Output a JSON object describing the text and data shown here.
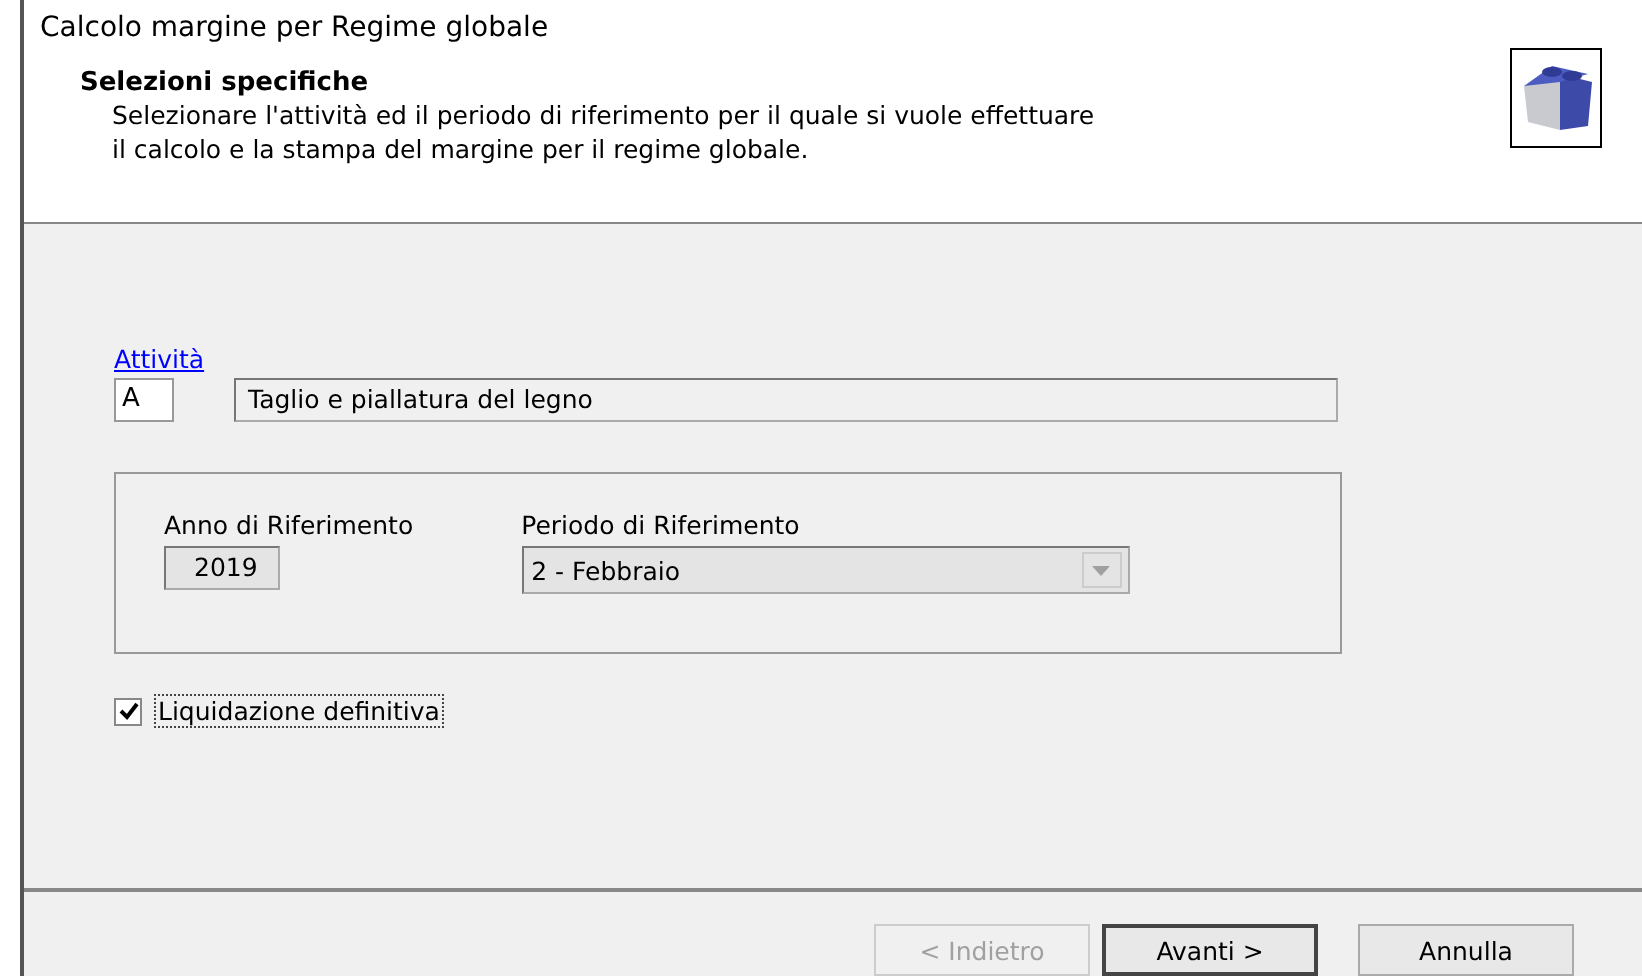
{
  "window": {
    "title": "Calcolo margine per Regime globale"
  },
  "header": {
    "heading": "Selezioni specifiche",
    "description": "Selezionare l'attività ed il periodo di riferimento per il quale si vuole effettuare\nil calcolo e la stampa del margine per il regime globale."
  },
  "activity": {
    "link": "Attività",
    "code": "A",
    "description": "Taglio e piallatura del legno"
  },
  "period_group": {
    "year_label": "Anno di Riferimento",
    "year": "2019",
    "period_label": "Periodo di Riferimento",
    "period": "2 - Febbraio"
  },
  "final_settlement": {
    "label": "Liquidazione definitiva",
    "checked": true
  },
  "buttons": [
    {
      "label": "< Indietro",
      "disabled": true,
      "default": false
    },
    {
      "label": "Avanti >",
      "disabled": false,
      "default": true
    },
    {
      "label": "Annulla",
      "disabled": false,
      "default": false
    }
  ]
}
